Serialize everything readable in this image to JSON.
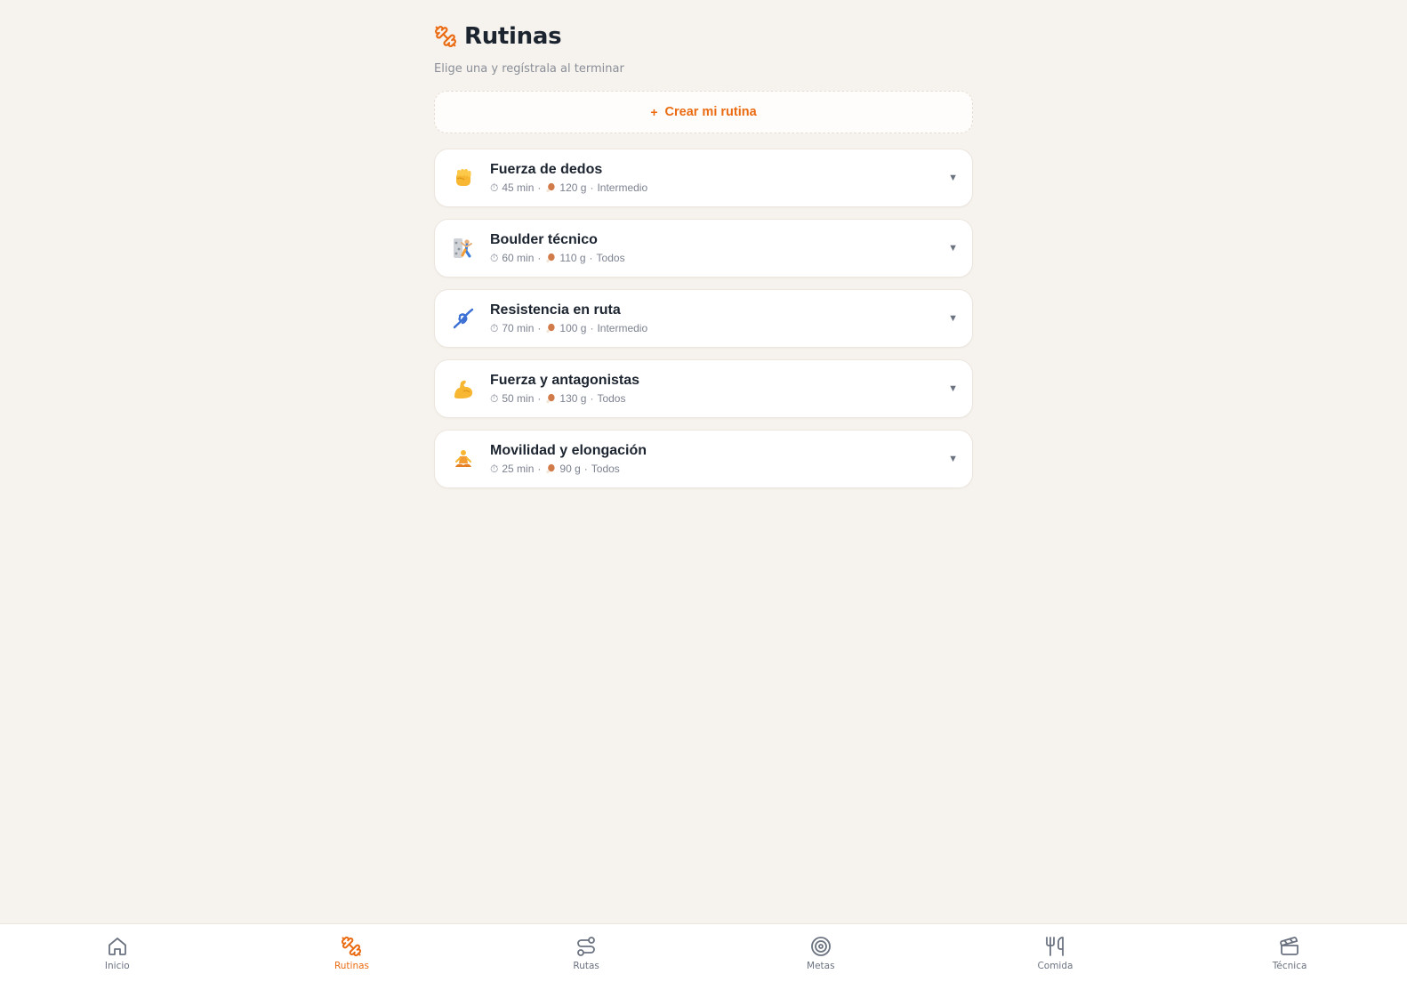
{
  "header": {
    "title": "Rutinas",
    "subtitle": "Elige una y regístrala al terminar",
    "icon": "dumbbell-icon",
    "accent": "#ea6b12"
  },
  "create_button": {
    "plus": "+",
    "label": "Crear mi rutina"
  },
  "routines": [
    {
      "name": "Fuerza de dedos",
      "icon": "raised-fist-emoji",
      "duration": "45 min",
      "protein": "120 g",
      "level": "Intermedio"
    },
    {
      "name": "Boulder técnico",
      "icon": "climber-emoji",
      "duration": "60 min",
      "protein": "110 g",
      "level": "Todos"
    },
    {
      "name": "Resistencia en ruta",
      "icon": "knot-emoji",
      "duration": "70 min",
      "protein": "100 g",
      "level": "Intermedio"
    },
    {
      "name": "Fuerza y antagonistas",
      "icon": "flexed-biceps-emoji",
      "duration": "50 min",
      "protein": "130 g",
      "level": "Todos"
    },
    {
      "name": "Movilidad y elongación",
      "icon": "lotus-position-emoji",
      "duration": "25 min",
      "protein": "90 g",
      "level": "Todos"
    }
  ],
  "nav": [
    {
      "label": "Inicio",
      "icon": "home-icon",
      "active": false
    },
    {
      "label": "Rutinas",
      "icon": "dumbbell-icon",
      "active": true
    },
    {
      "label": "Rutas",
      "icon": "route-icon",
      "active": false
    },
    {
      "label": "Metas",
      "icon": "target-icon",
      "active": false
    },
    {
      "label": "Comida",
      "icon": "fork-knife-icon",
      "active": false
    },
    {
      "label": "Técnica",
      "icon": "clapperboard-icon",
      "active": false
    }
  ]
}
